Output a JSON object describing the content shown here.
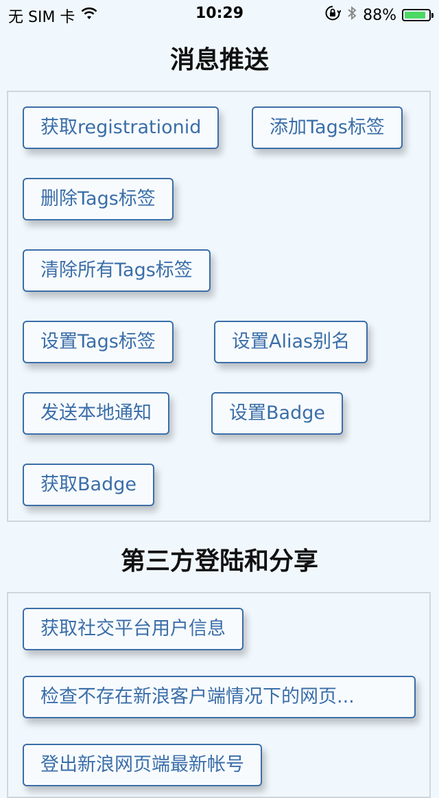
{
  "status_bar": {
    "carrier": "无 SIM 卡",
    "time": "10:29",
    "battery_text": "88%",
    "battery_level": 0.88,
    "battery_color": "#4cd964",
    "icons": [
      "wifi-icon",
      "orientation-lock-icon",
      "bluetooth-icon",
      "battery-icon"
    ]
  },
  "sections": [
    {
      "title": "消息推送",
      "buttons": [
        "获取registrationid",
        "添加Tags标签",
        "删除Tags标签",
        "清除所有Tags标签",
        "设置Tags标签",
        "设置Alias别名",
        "发送本地通知",
        "设置Badge",
        "获取Badge"
      ]
    },
    {
      "title": "第三方登陆和分享",
      "buttons": [
        "获取社交平台用户信息",
        "检查不存在新浪客户端情况下的网页...",
        "登出新浪网页端最新帐号"
      ]
    }
  ],
  "colors": {
    "background": "#f1f8fd",
    "button_border": "#3a6ea8",
    "button_text": "#3a6ea8",
    "panel_border": "#cfd6dc"
  }
}
